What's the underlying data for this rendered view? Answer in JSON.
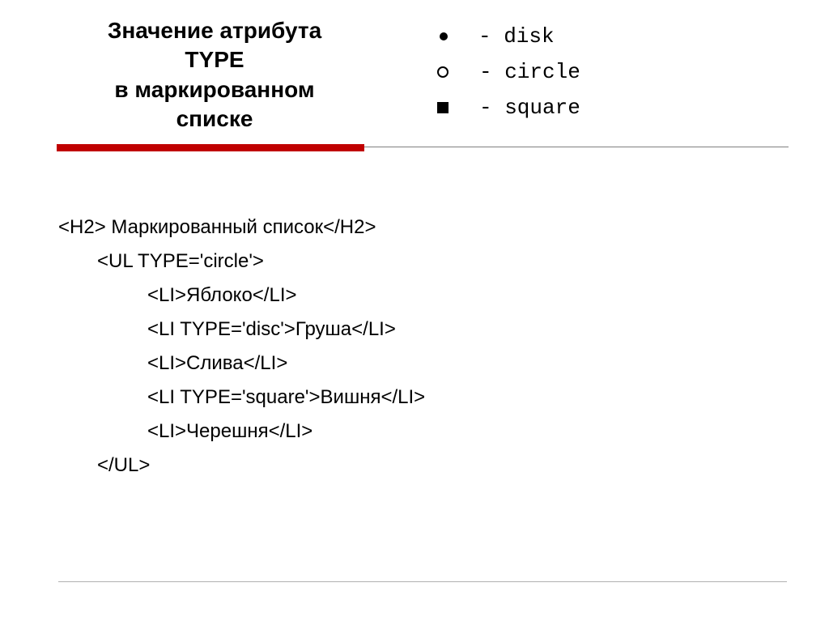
{
  "title": {
    "line1": "Значение атрибута",
    "line2": "TYPE",
    "line3": "в маркированном",
    "line4": "списке"
  },
  "legend": {
    "disk": "- disk",
    "circle": "- circle",
    "square": "- square"
  },
  "code": {
    "line1": "<H2> Маркированный список</H2>",
    "line2": "<UL TYPE='circle'>",
    "line3": "<LI>Яблоко</LI>",
    "line4": "<LI TYPE='disc'>Груша</LI>",
    "line5": "<LI>Слива</LI>",
    "line6": "<LI TYPE='square'>Вишня</LI>",
    "line7": "<LI>Черешня</LI>",
    "line8": "</UL>"
  }
}
